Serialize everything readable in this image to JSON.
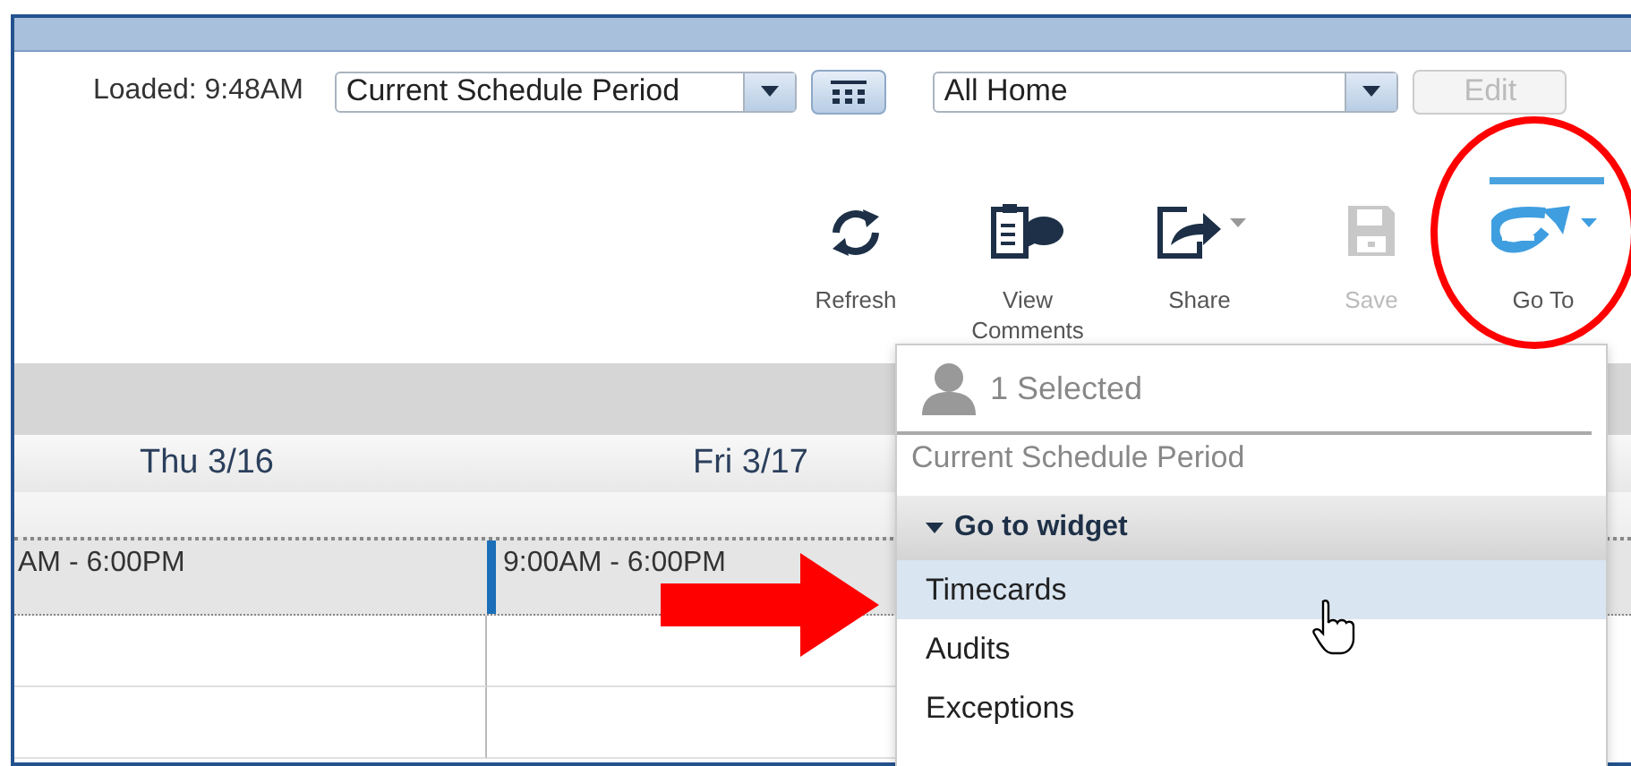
{
  "controls": {
    "loaded": "Loaded: 9:48AM",
    "period_select": {
      "value": "Current Schedule Period"
    },
    "location_select": {
      "value": "All Home"
    },
    "edit_button": {
      "label": "Edit",
      "disabled": true
    }
  },
  "toolbar": [
    {
      "kind": "refresh",
      "label": "Refresh",
      "disabled": false,
      "menu": false
    },
    {
      "kind": "comments",
      "label": "View Comments",
      "disabled": false,
      "menu": false
    },
    {
      "kind": "share",
      "label": "Share",
      "disabled": false,
      "menu": true
    },
    {
      "kind": "save",
      "label": "Save",
      "disabled": true,
      "menu": false
    },
    {
      "kind": "goto",
      "label": "Go To",
      "disabled": false,
      "menu": true
    }
  ],
  "schedule": {
    "days": [
      {
        "label": "Thu 3/16"
      },
      {
        "label": "Fri 3/17"
      }
    ],
    "shifts": [
      {
        "time": "AM - 6:00PM",
        "marked": false
      },
      {
        "time": "9:00AM - 6:00PM",
        "marked": true
      }
    ]
  },
  "goto_menu": {
    "selected_count": "1 Selected",
    "period": "Current Schedule Period",
    "section": {
      "label": "Go to widget",
      "expanded": true
    },
    "items": [
      {
        "label": "Timecards",
        "selected": true
      },
      {
        "label": "Audits",
        "selected": false
      },
      {
        "label": "Exceptions",
        "selected": false
      }
    ]
  }
}
